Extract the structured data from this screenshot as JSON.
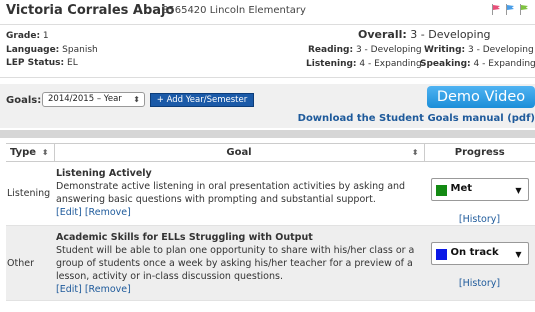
{
  "student": {
    "name": "Victoria Corrales Abajo",
    "id": "8565420",
    "school": "Lincoln Elementary"
  },
  "flags": [
    {
      "icon": "flag-icon",
      "color": "#e8507a"
    },
    {
      "icon": "flag-icon",
      "color": "#4a9ee8"
    },
    {
      "icon": "flag-icon",
      "color": "#7fc241"
    }
  ],
  "info": {
    "grade_label": "Grade:",
    "grade": "1",
    "language_label": "Language:",
    "language": "Spanish",
    "lep_label": "LEP Status:",
    "lep": "EL"
  },
  "proficiency": {
    "overall_label": "Overall:",
    "overall_value": "3 - Developing",
    "reading_label": "Reading:",
    "reading_value": "3 - Developing",
    "writing_label": "Writing:",
    "writing_value": "3 - Developing",
    "listening_label": "Listening:",
    "listening_value": "4 - Expanding",
    "speaking_label": "Speaking:",
    "speaking_value": "4 - Expanding"
  },
  "goals_bar": {
    "label": "Goals:",
    "year_selected": "2014/2015 – Year",
    "add_button": "+ Add Year/Semester",
    "demo_button": "Demo Video",
    "manual_link": "Download the Student Goals manual (pdf)"
  },
  "table": {
    "headers": {
      "type": "Type",
      "goal": "Goal",
      "progress": "Progress"
    },
    "rows": [
      {
        "type": "Listening",
        "title": "Listening Actively",
        "description": "Demonstrate active listening in oral presentation activities by asking and answering basic questions with prompting and substantial support.",
        "edit": "[Edit]",
        "remove": "[Remove]",
        "progress": "Met",
        "progress_color": "#138a13",
        "history": "[History]"
      },
      {
        "type": "Other",
        "title": "Academic Skills for ELLs Struggling with Output",
        "description": "Student will be able to plan one opportunity to share with his/her class or a group of students once a week by asking his/her teacher for a preview of a lesson, activity or in-class discussion questions.",
        "edit": "[Edit]",
        "remove": "[Remove]",
        "progress": "On track",
        "progress_color": "#0a18e6",
        "history": "[History]"
      }
    ]
  }
}
